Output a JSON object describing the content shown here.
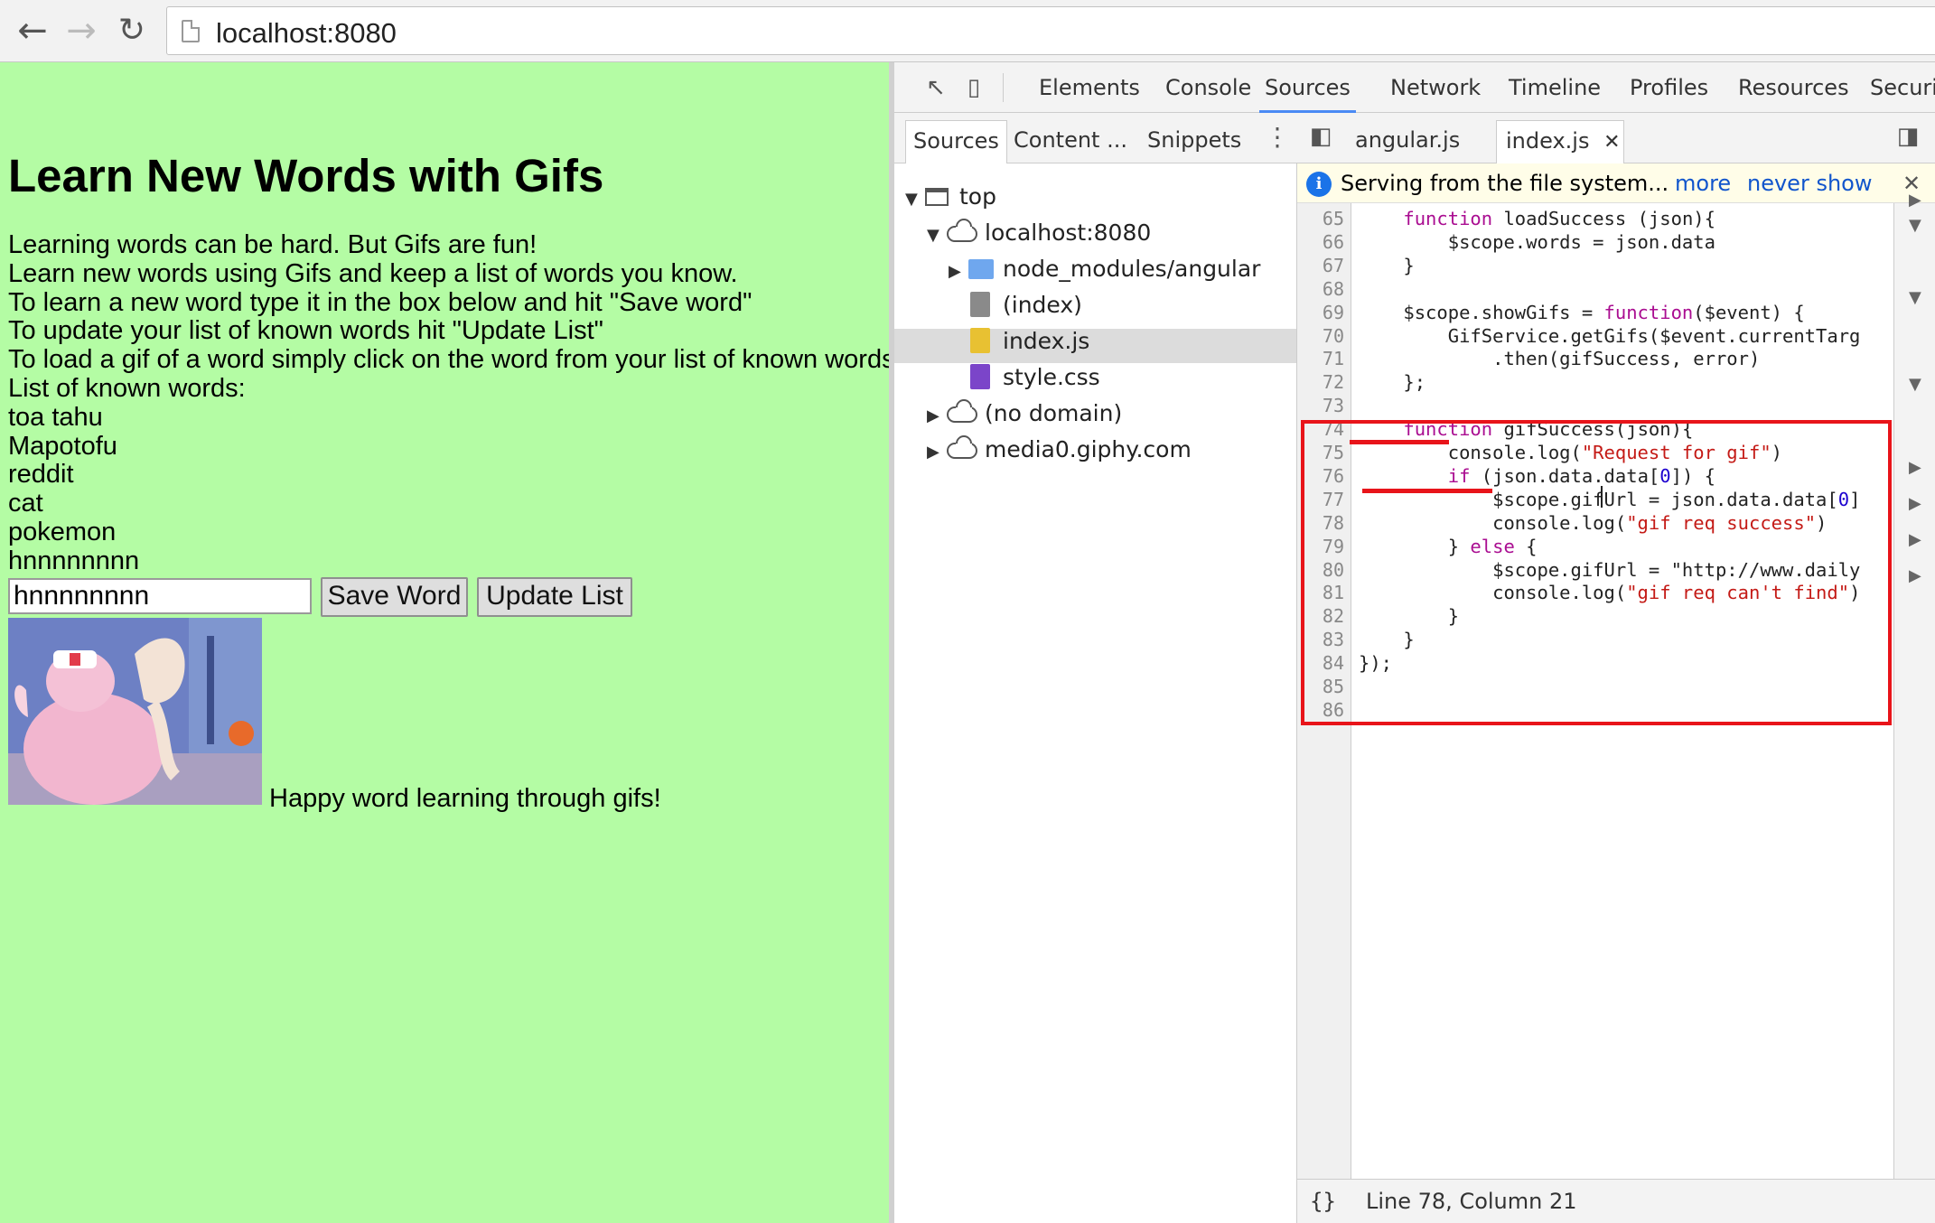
{
  "browser": {
    "url": "localhost:8080",
    "back_icon": "back-arrow-icon",
    "forward_icon": "forward-arrow-icon",
    "reload_icon": "reload-icon"
  },
  "page": {
    "heading": "Learn New Words with Gifs",
    "intro_lines": [
      "Learning words can be hard. But Gifs are fun!",
      "Learn new words using Gifs and keep a list of words you know.",
      "To learn a new word type it in the box below and hit \"Save word\"",
      "To update your list of known words hit \"Update List\"",
      "To load a gif of a word simply click on the word from your list of known words",
      "List of known words:"
    ],
    "known_words": [
      "toa tahu",
      "Mapotofu",
      "reddit",
      "cat",
      "pokemon",
      "hnnnnnnnn"
    ],
    "word_input_value": "hnnnnnnnn",
    "save_button": "Save Word",
    "update_button": "Update List",
    "gif_caption": "Happy word learning through gifs!",
    "background_color": "#b4fca4"
  },
  "devtools": {
    "tabs": [
      "Elements",
      "Console",
      "Sources",
      "Network",
      "Timeline",
      "Profiles",
      "Resources",
      "Securi"
    ],
    "active_tab": "Sources",
    "navigator_tabs": [
      "Sources",
      "Content ...",
      "Snippets"
    ],
    "tree": [
      {
        "label": "top",
        "icon": "frame-icon"
      },
      {
        "label": "localhost:8080",
        "icon": "cloud-icon"
      },
      {
        "label": "node_modules/angular",
        "icon": "folder-icon"
      },
      {
        "label": "(index)",
        "icon": "file-icon",
        "selected": true
      },
      {
        "label": "index.js",
        "icon": "js-file-icon"
      },
      {
        "label": "style.css",
        "icon": "css-file-icon"
      },
      {
        "label": "(no domain)",
        "icon": "cloud-icon"
      },
      {
        "label": "media0.giphy.com",
        "icon": "cloud-icon"
      }
    ],
    "editor_tabs": [
      "angular.js",
      "index.js"
    ],
    "active_editor_tab": "index.js",
    "infobar": {
      "message": "Serving from the file system...",
      "more": "more",
      "never_show": "never show"
    },
    "status": "Line 78, Column 21",
    "format_icon": "{}",
    "highlight_color": "#e8141a",
    "code_lines": [
      {
        "n": "65",
        "t": "    function loadSuccess (json){"
      },
      {
        "n": "66",
        "t": "        $scope.words = json.data"
      },
      {
        "n": "67",
        "t": "    }"
      },
      {
        "n": "68",
        "t": ""
      },
      {
        "n": "69",
        "t": "    $scope.showGifs = function($event) {"
      },
      {
        "n": "70",
        "t": "        GifService.getGifs($event.currentTarg"
      },
      {
        "n": "71",
        "t": "            .then(gifSuccess, error)"
      },
      {
        "n": "72",
        "t": "    };"
      },
      {
        "n": "73",
        "t": ""
      },
      {
        "n": "74",
        "t": "    function gifSuccess(json){"
      },
      {
        "n": "75",
        "t": "        console.log(\"Request for gif\")"
      },
      {
        "n": "76",
        "t": "        if (json.data.data[0]) {"
      },
      {
        "n": "77",
        "t": "            $scope.gifUrl = json.data.data[0]"
      },
      {
        "n": "78",
        "t": "            console.log(\"gif req success\")"
      },
      {
        "n": "79",
        "t": "        } else {"
      },
      {
        "n": "80",
        "t": "            $scope.gifUrl = \"http://www.daily"
      },
      {
        "n": "81",
        "t": "            console.log(\"gif req can't find\")"
      },
      {
        "n": "82",
        "t": "        }"
      },
      {
        "n": "83",
        "t": "    }"
      },
      {
        "n": "84",
        "t": "});"
      },
      {
        "n": "85",
        "t": ""
      },
      {
        "n": "86",
        "t": ""
      }
    ]
  }
}
